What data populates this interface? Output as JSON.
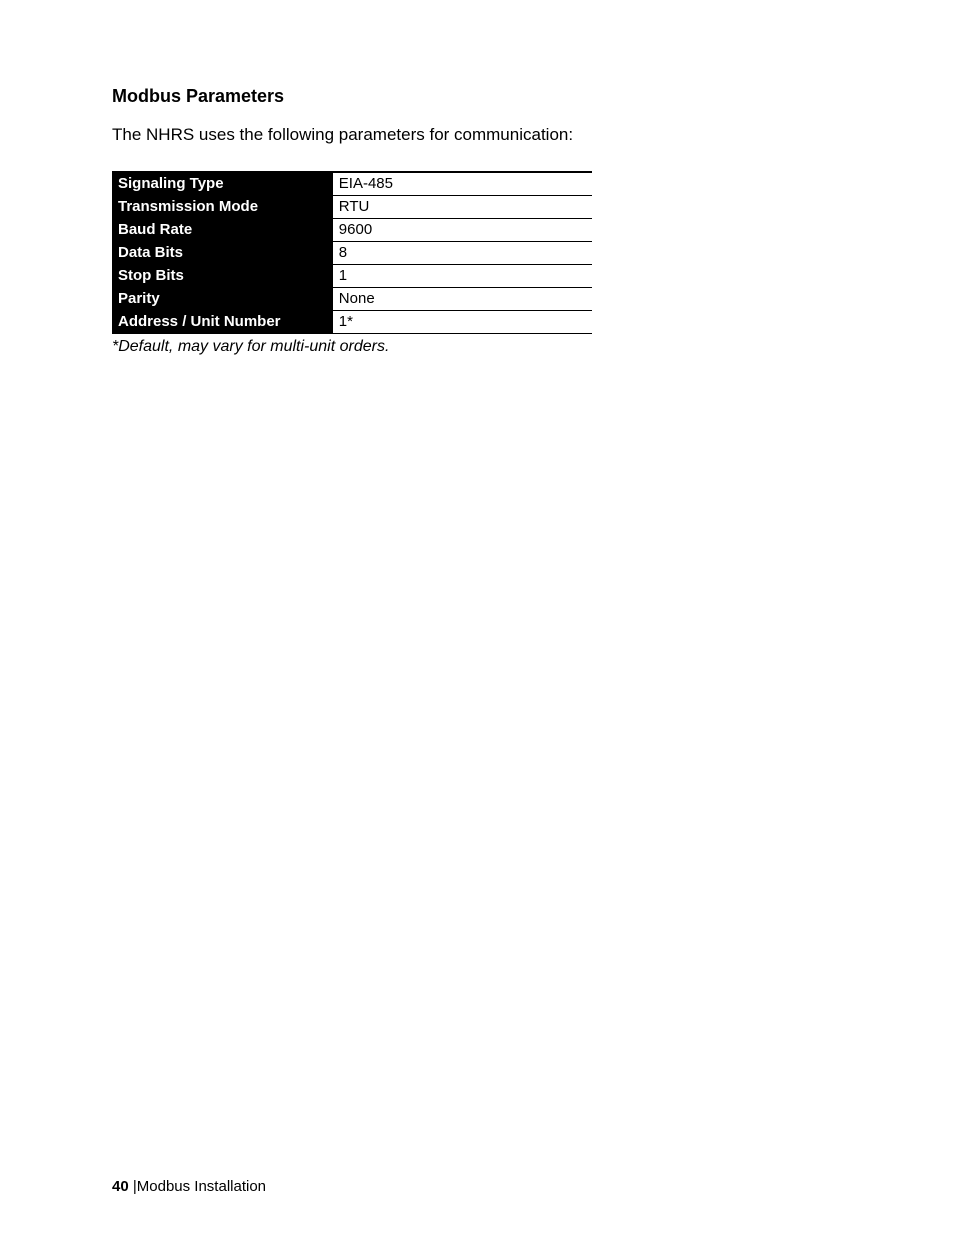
{
  "heading": "Modbus Parameters",
  "intro": "The NHRS uses the following parameters for communication:",
  "rows": [
    {
      "label": "Signaling Type",
      "value": "EIA-485"
    },
    {
      "label": "Transmission Mode",
      "value": "RTU"
    },
    {
      "label": "Baud Rate",
      "value": "9600"
    },
    {
      "label": "Data Bits",
      "value": "8"
    },
    {
      "label": "Stop Bits",
      "value": "1"
    },
    {
      "label": "Parity",
      "value": "None"
    },
    {
      "label": "Address / Unit Number",
      "value": "1*"
    }
  ],
  "footnote": "*Default, may vary for multi-unit orders.",
  "footer": {
    "page": "40",
    "sep": " |",
    "section": "Modbus Installation"
  }
}
